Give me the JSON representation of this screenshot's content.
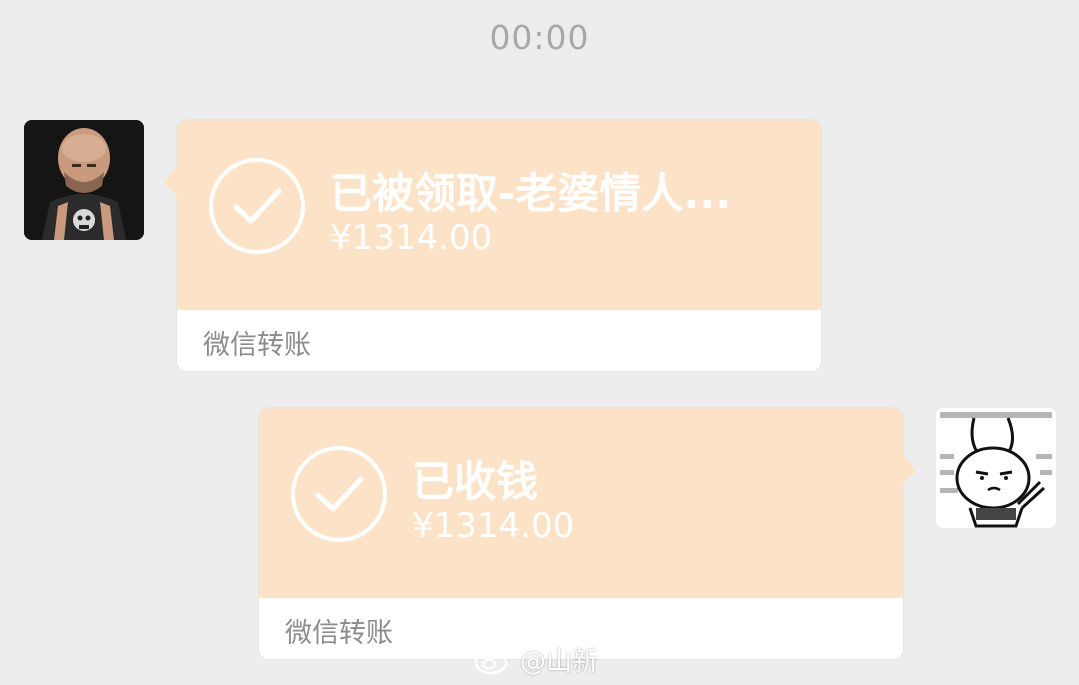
{
  "timestamp": "00:00",
  "messages": [
    {
      "side": "left",
      "avatar_icon": "bald-man-avatar",
      "title": "已被领取-老婆情人...",
      "amount": "¥1314.00",
      "footer": "微信转账",
      "status_icon": "check-circle-icon"
    },
    {
      "side": "right",
      "avatar_icon": "rabbit-sticker-avatar",
      "title": "已收钱",
      "amount": "¥1314.00",
      "footer": "微信转账",
      "status_icon": "check-circle-icon"
    }
  ],
  "watermark": {
    "logo_icon": "weibo-logo-icon",
    "handle": "@山新"
  },
  "colors": {
    "background": "#EDEDED",
    "card_bg": "#FCE3C8",
    "card_text": "#FFFFFF",
    "footer_bg": "#FFFFFF",
    "footer_text": "#8C8C8C",
    "timestamp": "#A8A8A8"
  }
}
